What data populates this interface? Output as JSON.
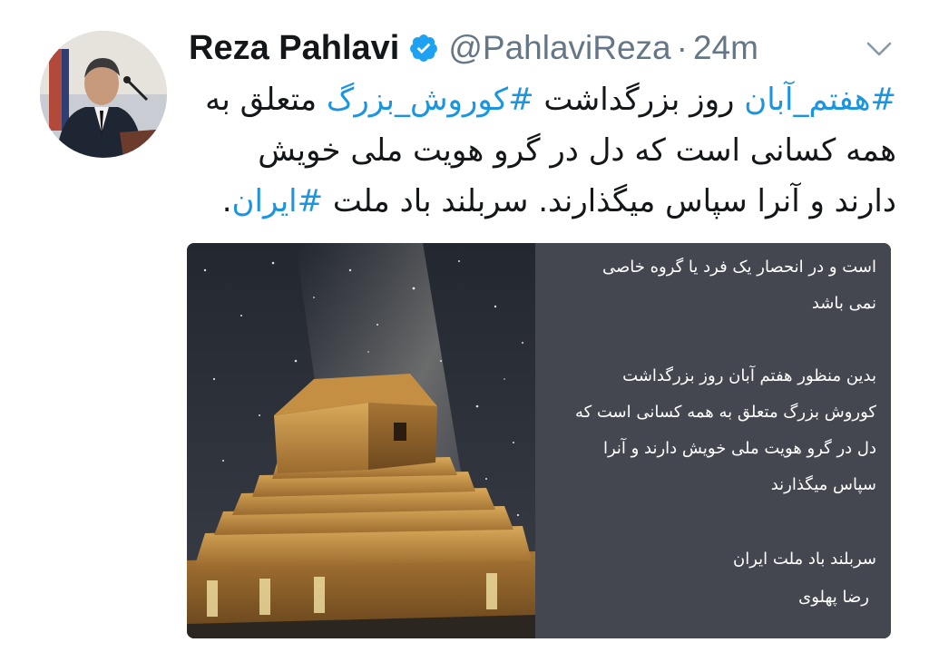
{
  "author": {
    "display_name": "Reza Pahlavi",
    "handle": "@PahlaviReza",
    "separator": "·",
    "timestamp": "24m",
    "verified": true,
    "verified_color": "#1da1f2"
  },
  "tweet": {
    "lines": [
      {
        "h1": "#هفتم_آبان",
        "t1": " روز بزرگداشت ",
        "h2": "#کوروش_بزرگ",
        "t2": " متعلق به"
      },
      {
        "text": "همه کسانی است که دل در گرو هویت ملی خویش"
      },
      {
        "t1": "دارند و آنرا سپاس میگذارند. سربلند باد ملت ",
        "h1": "#ایران",
        "t2": "."
      }
    ],
    "hashtag_color": "#1b95e0"
  },
  "media": {
    "statement_lines": [
      "است و در انحصار یک فرد یا گروه خاصی",
      "نمی باشد",
      "بدین منظور هفتم آبان روز بزرگداشت",
      "کوروش بزرگ متعلق به همه کسانی است که",
      "دل در گرو هویت ملی خویش دارند و آنرا",
      "سپاس میگذارند",
      "سربلند باد ملت ایران",
      "رضا پهلوی"
    ],
    "panel_color": "#44474f"
  },
  "icons": {
    "verified": "verified-badge-icon",
    "menu": "chevron-down-icon"
  }
}
